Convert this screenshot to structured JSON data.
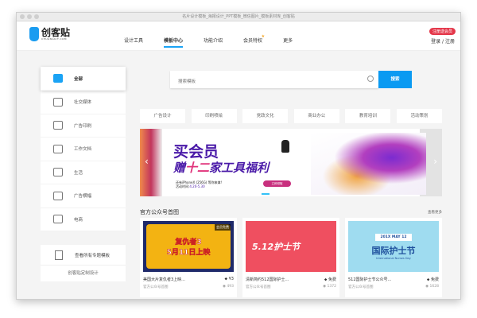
{
  "window": {
    "title": "名片设计模板_海报设计_PPT模板_微信图片_模板素材库_创客贴"
  },
  "header": {
    "logo": "创客贴",
    "logo_sub": "CHUANGKIT.COM",
    "nav": [
      "设计工具",
      "模板中心",
      "功能介绍",
      "会员特权",
      "更多"
    ],
    "active_nav": 1,
    "badge": "注册送会员",
    "login": "登录",
    "separator": "/",
    "register": "注册"
  },
  "sidebar": {
    "items": [
      "全部",
      "社交媒体",
      "广告印刷",
      "工作文档",
      "生活",
      "广告横幅",
      "电商"
    ],
    "all_topics": "查看所有专题模板",
    "custom": "创客贴定制设计"
  },
  "search": {
    "placeholder": "搜索模板",
    "button": "搜索"
  },
  "categories": [
    "广告设计",
    "印刷喷绘",
    "党政文化",
    "商业办公",
    "教育培训",
    "活动策划"
  ],
  "banner": {
    "line1": "买会员",
    "line2a": "赠",
    "line2b": "十二",
    "line2c": "家工具福利",
    "line3": "还有iPhoneX (256G) 等你来拿!",
    "line4_label": "活动时间:",
    "line4_dates": "4.20-5.30",
    "button": "立即领取"
  },
  "section": {
    "title": "官方公众号首图",
    "more": "查看更多"
  },
  "cards": [
    {
      "title": "美国大片复仇者3上映...",
      "category": "官方公众号首图",
      "price": "¥3",
      "views": "493",
      "badge": "会员免费",
      "thumb_l1": "复仇者3",
      "thumb_l2": "5月11日上映"
    },
    {
      "title": "清新简约512国际护士...",
      "category": "官方公众号首图",
      "price": "免费",
      "views": "1372",
      "thumb_l1": "5.12护士节"
    },
    {
      "title": "512国际护士节公众号...",
      "category": "官方公众号首图",
      "price": "免费",
      "views": "1628",
      "thumb_date": "201X  MAY  12",
      "thumb_l1": "国际护士节",
      "thumb_l2": "International Nurses Day"
    }
  ],
  "colors": {
    "accent": "#0a9af2",
    "badge": "#e4374a",
    "banner_purple": "#4a1aa8"
  }
}
